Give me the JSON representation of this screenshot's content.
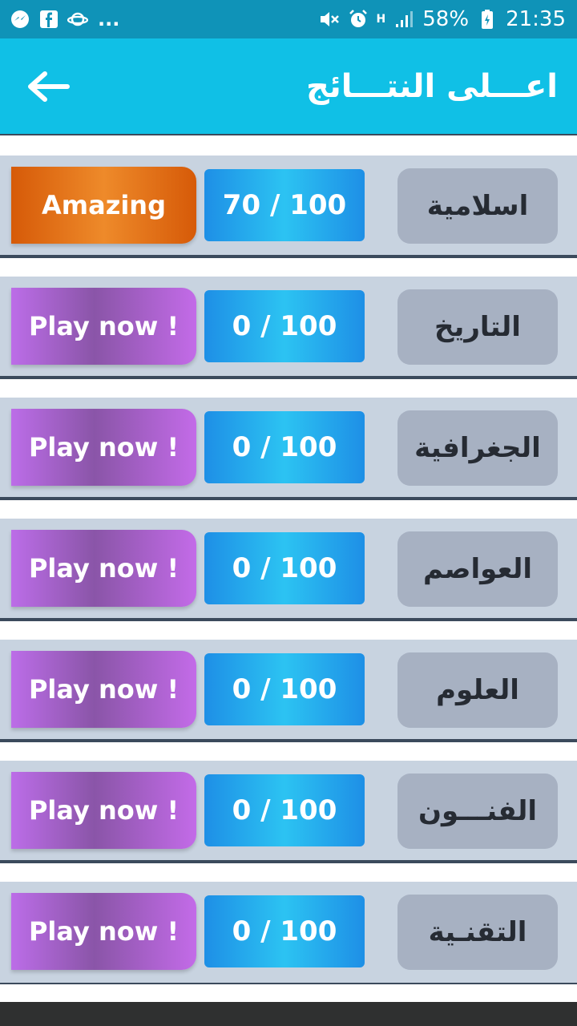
{
  "status_bar": {
    "left_more": "...",
    "battery": "58%",
    "time": "21:35",
    "network": "H"
  },
  "header": {
    "title": "اعـــلى النتـــائج"
  },
  "rows": [
    {
      "category": "اسلامية",
      "score": "70 / 100",
      "action": "Amazing",
      "kind": "amazing"
    },
    {
      "category": "التاريخ",
      "score": "0 / 100",
      "action": "Play now !",
      "kind": "play"
    },
    {
      "category": "الجغرافية",
      "score": "0 / 100",
      "action": "Play now !",
      "kind": "play"
    },
    {
      "category": "العواصم",
      "score": "0 / 100",
      "action": "Play now !",
      "kind": "play"
    },
    {
      "category": "العلوم",
      "score": "0 / 100",
      "action": "Play now !",
      "kind": "play"
    },
    {
      "category": "الفنـــون",
      "score": "0 / 100",
      "action": "Play now !",
      "kind": "play"
    },
    {
      "category": "التقنـية",
      "score": "0 / 100",
      "action": "Play now !",
      "kind": "play"
    }
  ],
  "colors": {
    "status_bar": "#0f93b8",
    "app_bar": "#10c0e6",
    "row_bg": "#c8d3e0",
    "category_bg": "#a7b1c2",
    "score_blue": "#2cc3f2",
    "amazing_orange": "#ee8a2a",
    "play_purple": "#bc6de8"
  },
  "icons": {
    "back": "arrow-left-icon",
    "messenger": "messenger-icon",
    "facebook": "facebook-icon",
    "saturn": "planet-icon",
    "mute": "volume-mute-icon",
    "alarm": "alarm-icon",
    "signal": "signal-icon",
    "battery": "battery-charging-icon"
  }
}
